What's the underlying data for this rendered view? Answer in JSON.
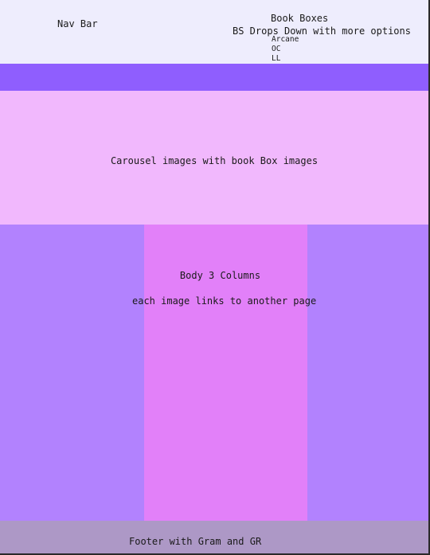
{
  "navbar": {
    "label": "Nav Bar",
    "book_boxes": {
      "title": "Book Boxes",
      "description": "BS Drops Down with more options",
      "options": [
        "Arcane",
        "OC",
        "LL"
      ]
    }
  },
  "carousel": {
    "label": "Carousel images with book Box images"
  },
  "body": {
    "title": "Body 3 Columns",
    "description": "each image links to another page"
  },
  "footer": {
    "label": "Footer with Gram and GR"
  },
  "colors": {
    "navbar": "#eeedfd",
    "accent_bar": "#8f5efe",
    "carousel": "#f1b8fd",
    "side_columns": "#b282fe",
    "middle_column": "#e280f9",
    "footer": "#ad98c6"
  }
}
